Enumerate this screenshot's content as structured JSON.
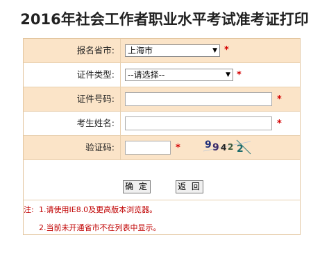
{
  "page": {
    "title": "2016年社会工作者职业水平考试准考证打印"
  },
  "form": {
    "province": {
      "label": "报名省市:",
      "value": "上海市"
    },
    "id_type": {
      "label": "证件类型:",
      "value": "--请选择--"
    },
    "id_number": {
      "label": "证件号码:",
      "value": ""
    },
    "name": {
      "label": "考生姓名:",
      "value": ""
    },
    "captcha": {
      "label": "验证码:",
      "value": "",
      "image_text": "99422"
    },
    "required_mark": "*"
  },
  "buttons": {
    "confirm": "确 定",
    "back": "返 回"
  },
  "notes": {
    "prefix": "注:",
    "line1": "1.请使用IE8.0及更高版本浏览器。",
    "line2": "2.当前未开通省市不在列表中显示。"
  },
  "colors": {
    "row_alt": "#fbe4c8",
    "border": "#e3c6a0",
    "required": "#d40000",
    "note": "#c00000"
  }
}
